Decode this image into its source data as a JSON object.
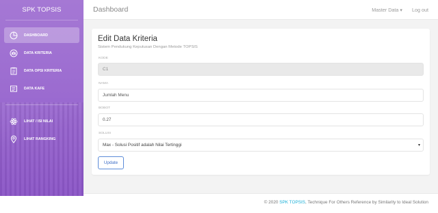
{
  "sidebar": {
    "brand": "SPK TOPSIS",
    "items": [
      {
        "label": "DASHBOARD",
        "icon": "pie-chart-icon",
        "active": true
      },
      {
        "label": "DATA KRITERIA",
        "icon": "scale-icon"
      },
      {
        "label": "DATA OPSI KRITERIA",
        "icon": "clipboard-icon"
      },
      {
        "label": "DATA KAFE",
        "icon": "notes-icon"
      },
      {
        "label": "LIHAT / ISI NILAI",
        "icon": "atom-icon"
      },
      {
        "label": "LIHAT RANGKING",
        "icon": "map-pin-icon"
      }
    ]
  },
  "topbar": {
    "title": "Dashboard",
    "master_data": "Master Data ▾",
    "logout": "Log out"
  },
  "form": {
    "title": "Edit Data Kriteria",
    "subtitle": "Sistem Pendukung Keputusan Dengan Metode TOPSIS",
    "kode_label": "KODE",
    "kode_value": "C1",
    "nama_label": "NAMA",
    "nama_value": "Jumlah Menu",
    "bobot_label": "BOBOT",
    "bobot_value": "0.27",
    "solusi_label": "SOLUSI",
    "solusi_value": "Max - Solusi Positif adalah Nilai Tertinggi",
    "update_label": "Update"
  },
  "footer": {
    "prefix": "© 2020 ",
    "link": "SPK TOPSIS",
    "suffix": ", Technique For Others Reference by Similarity to Ideal Solution"
  },
  "colors": {
    "sidebar_purple": "#9b6bd0",
    "accent_blue": "#3f6fc7",
    "link_cyan": "#1cb0d8"
  }
}
